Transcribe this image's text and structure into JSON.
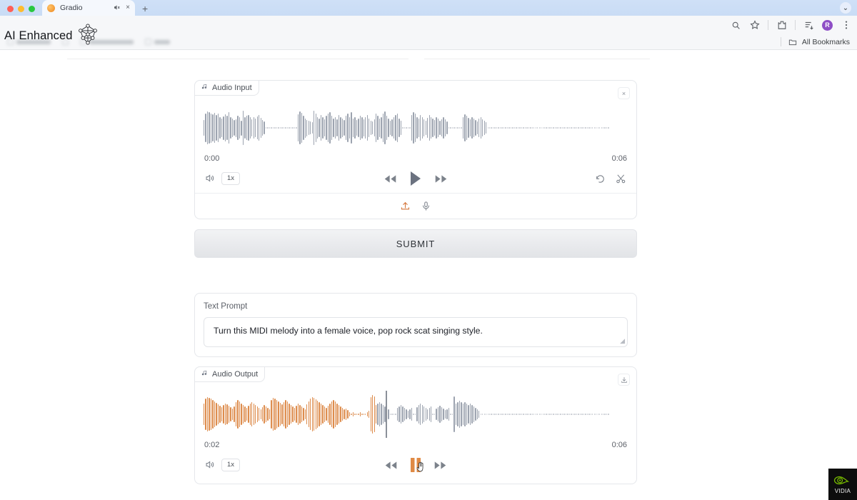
{
  "browser": {
    "tab": {
      "title": "Gradio",
      "audio_icon": "speaker-muted-icon",
      "close_icon": "×"
    },
    "new_tab_label": "+",
    "tab_list_chevron": "⌄",
    "toolbar_icons": [
      "zoom-icon",
      "bookmark-star-icon",
      "extensions-icon",
      "reading-list-icon",
      "profile-avatar",
      "chrome-menu-icon"
    ],
    "profile_initial": "R",
    "bookmarks_label": "All Bookmarks"
  },
  "overlay": {
    "watermark_text": "AI Enhanced",
    "watermark_icon": "network-graph-icon",
    "brand_logo": "nvidia-logo",
    "brand_text": "VIDIA"
  },
  "audio_input": {
    "label": "Audio Input",
    "label_icon": "music-note-icon",
    "close_icon": "×",
    "time_start": "0:00",
    "time_end": "0:06",
    "volume_icon": "volume-icon",
    "speed_label": "1x",
    "rewind_icon": "rewind-icon",
    "play_icon": "play-icon",
    "forward_icon": "fast-forward-icon",
    "undo_icon": "undo-icon",
    "trim_icon": "scissors-icon",
    "upload_icon": "upload-icon",
    "mic_icon": "microphone-icon",
    "waveform": {
      "color": "#9ca3af",
      "heights": [
        22,
        40,
        46,
        44,
        41,
        38,
        42,
        36,
        40,
        30,
        26,
        33,
        38,
        34,
        44,
        30,
        26,
        22,
        25,
        34,
        30,
        21,
        48,
        30,
        34,
        36,
        30,
        24,
        30,
        26,
        32,
        36,
        28,
        22,
        18,
        0,
        0,
        0,
        0,
        0,
        0,
        0,
        0,
        0,
        0,
        0,
        0,
        0,
        0,
        0,
        0,
        0,
        0,
        38,
        46,
        42,
        34,
        27,
        23,
        20,
        18,
        16,
        48,
        40,
        30,
        26,
        36,
        30,
        24,
        34,
        40,
        44,
        34,
        26,
        30,
        24,
        36,
        30,
        26,
        22,
        34,
        40,
        30,
        44,
        26,
        30,
        22,
        26,
        34,
        30,
        24,
        30,
        36,
        26,
        20,
        18,
        24,
        40,
        34,
        26,
        30,
        40,
        46,
        34,
        26,
        20,
        24,
        30,
        36,
        40,
        26,
        20,
        0,
        0,
        0,
        0,
        0,
        36,
        44,
        40,
        30,
        26,
        36,
        30,
        24,
        20,
        28,
        36,
        30,
        26,
        22,
        30,
        26,
        20,
        24,
        30,
        24,
        18,
        0,
        0,
        0,
        0,
        0,
        0,
        0,
        0,
        30,
        38,
        34,
        28,
        24,
        30,
        26,
        22,
        18,
        26,
        30,
        24,
        20,
        16,
        0,
        0,
        0,
        0,
        0,
        0,
        0,
        0,
        0,
        0,
        0,
        0,
        0,
        0,
        0,
        0,
        0,
        0,
        0,
        0,
        0,
        0,
        0,
        0,
        0,
        0,
        0,
        0,
        0,
        0,
        0,
        0,
        0,
        0,
        0,
        0,
        0,
        0,
        0,
        0,
        0,
        0,
        0,
        0,
        0,
        0,
        0,
        0,
        0,
        0,
        0,
        0,
        0,
        0,
        0,
        0,
        0,
        0,
        0,
        0,
        0,
        0,
        0,
        0,
        0,
        0,
        0,
        0,
        0
      ]
    }
  },
  "submit": {
    "label": "SUBMIT"
  },
  "text_prompt": {
    "label": "Text Prompt",
    "value": "Turn this MIDI melody into a female voice, pop rock scat singing style.",
    "placeholder": ""
  },
  "audio_output": {
    "label": "Audio Output",
    "label_icon": "music-note-icon",
    "download_icon": "download-icon",
    "time_start": "0:02",
    "time_end": "0:06",
    "volume_icon": "volume-icon",
    "speed_label": "1x",
    "rewind_icon": "rewind-icon",
    "pause_icon": "pause-icon",
    "forward_icon": "fast-forward-icon",
    "cursor_icon": "pointer-hand-cursor",
    "played_color": "#dd8b4b",
    "unplayed_color": "#9ca3af",
    "playhead_position_pct": 43,
    "waveform": {
      "heights": [
        30,
        44,
        48,
        46,
        44,
        40,
        36,
        32,
        28,
        24,
        20,
        26,
        30,
        28,
        24,
        20,
        16,
        22,
        34,
        40,
        36,
        30,
        26,
        22,
        18,
        24,
        30,
        34,
        30,
        26,
        22,
        18,
        14,
        20,
        26,
        22,
        18,
        14,
        40,
        46,
        44,
        40,
        36,
        32,
        28,
        34,
        40,
        36,
        30,
        26,
        22,
        18,
        24,
        30,
        26,
        22,
        18,
        14,
        28,
        36,
        44,
        48,
        46,
        42,
        38,
        34,
        30,
        26,
        22,
        18,
        24,
        30,
        36,
        40,
        36,
        30,
        26,
        22,
        18,
        14,
        16,
        12,
        6,
        4,
        6,
        4,
        3,
        4,
        6,
        4,
        3,
        4,
        6,
        10,
        48,
        54,
        50,
        26,
        30,
        34,
        30,
        26,
        22,
        18,
        14,
        4,
        3,
        4,
        3,
        18,
        22,
        26,
        22,
        18,
        14,
        10,
        14,
        18,
        3,
        3,
        20,
        26,
        30,
        26,
        22,
        18,
        14,
        18,
        22,
        3,
        3,
        16,
        20,
        24,
        20,
        16,
        12,
        14,
        18,
        3,
        3,
        50,
        30,
        34,
        38,
        34,
        30,
        34,
        30,
        26,
        30,
        26,
        22,
        18,
        14,
        10,
        3,
        3,
        3,
        3,
        3,
        3,
        3,
        3,
        3,
        3,
        3,
        3,
        3,
        3,
        3,
        3,
        3,
        3,
        3,
        3,
        3,
        3,
        3,
        3,
        3,
        3,
        3,
        3,
        3,
        3,
        3,
        3,
        3,
        3,
        3,
        3,
        3,
        3,
        3,
        3,
        3,
        3,
        3,
        3,
        3,
        3,
        3,
        3,
        3,
        3,
        3,
        3,
        3,
        3,
        3,
        3,
        3,
        3,
        3,
        3,
        3,
        3,
        3,
        3,
        3,
        3,
        3,
        3,
        3,
        3,
        3,
        3,
        3
      ]
    }
  }
}
